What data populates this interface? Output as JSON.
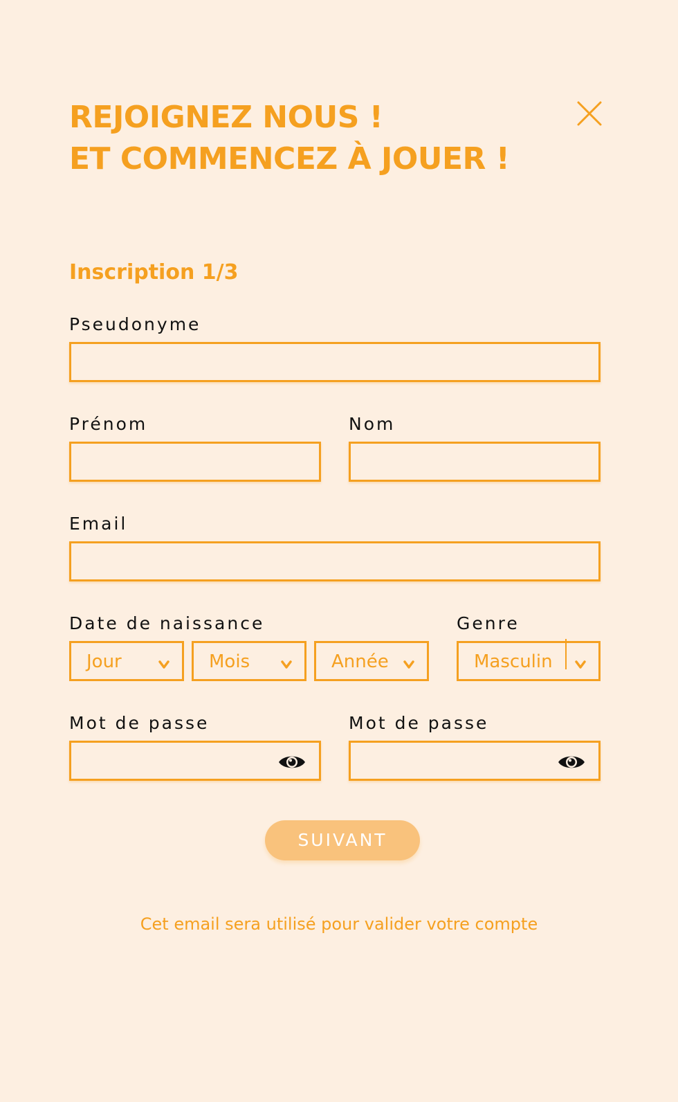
{
  "header": {
    "title_line1": "REJOIGNEZ NOUS !",
    "title_line2": "ET COMMENCEZ À JOUER !",
    "close_icon": "close-icon"
  },
  "form": {
    "step": "Inscription 1/3",
    "pseudonyme": {
      "label": "Pseudonyme",
      "value": ""
    },
    "prenom": {
      "label": "Prénom",
      "value": ""
    },
    "nom": {
      "label": "Nom",
      "value": ""
    },
    "email": {
      "label": "Email",
      "value": ""
    },
    "birthdate": {
      "label": "Date de naissance",
      "day": "Jour",
      "month": "Mois",
      "year": "Année"
    },
    "genre": {
      "label": "Genre",
      "value": "Masculin"
    },
    "password": {
      "label": "Mot de passe",
      "value": ""
    },
    "password_confirm": {
      "label": "Mot de passe",
      "value": ""
    },
    "submit_label": "SUIVANT",
    "footnote": "Cet email sera utilisé pour valider votre compte"
  },
  "colors": {
    "background": "#FDEFE1",
    "accent": "#F5A020",
    "button": "#F9C27C",
    "text": "#111111"
  },
  "icons": {
    "close": "close-icon",
    "chevron": "chevron-down-icon",
    "eye": "eye-icon"
  }
}
